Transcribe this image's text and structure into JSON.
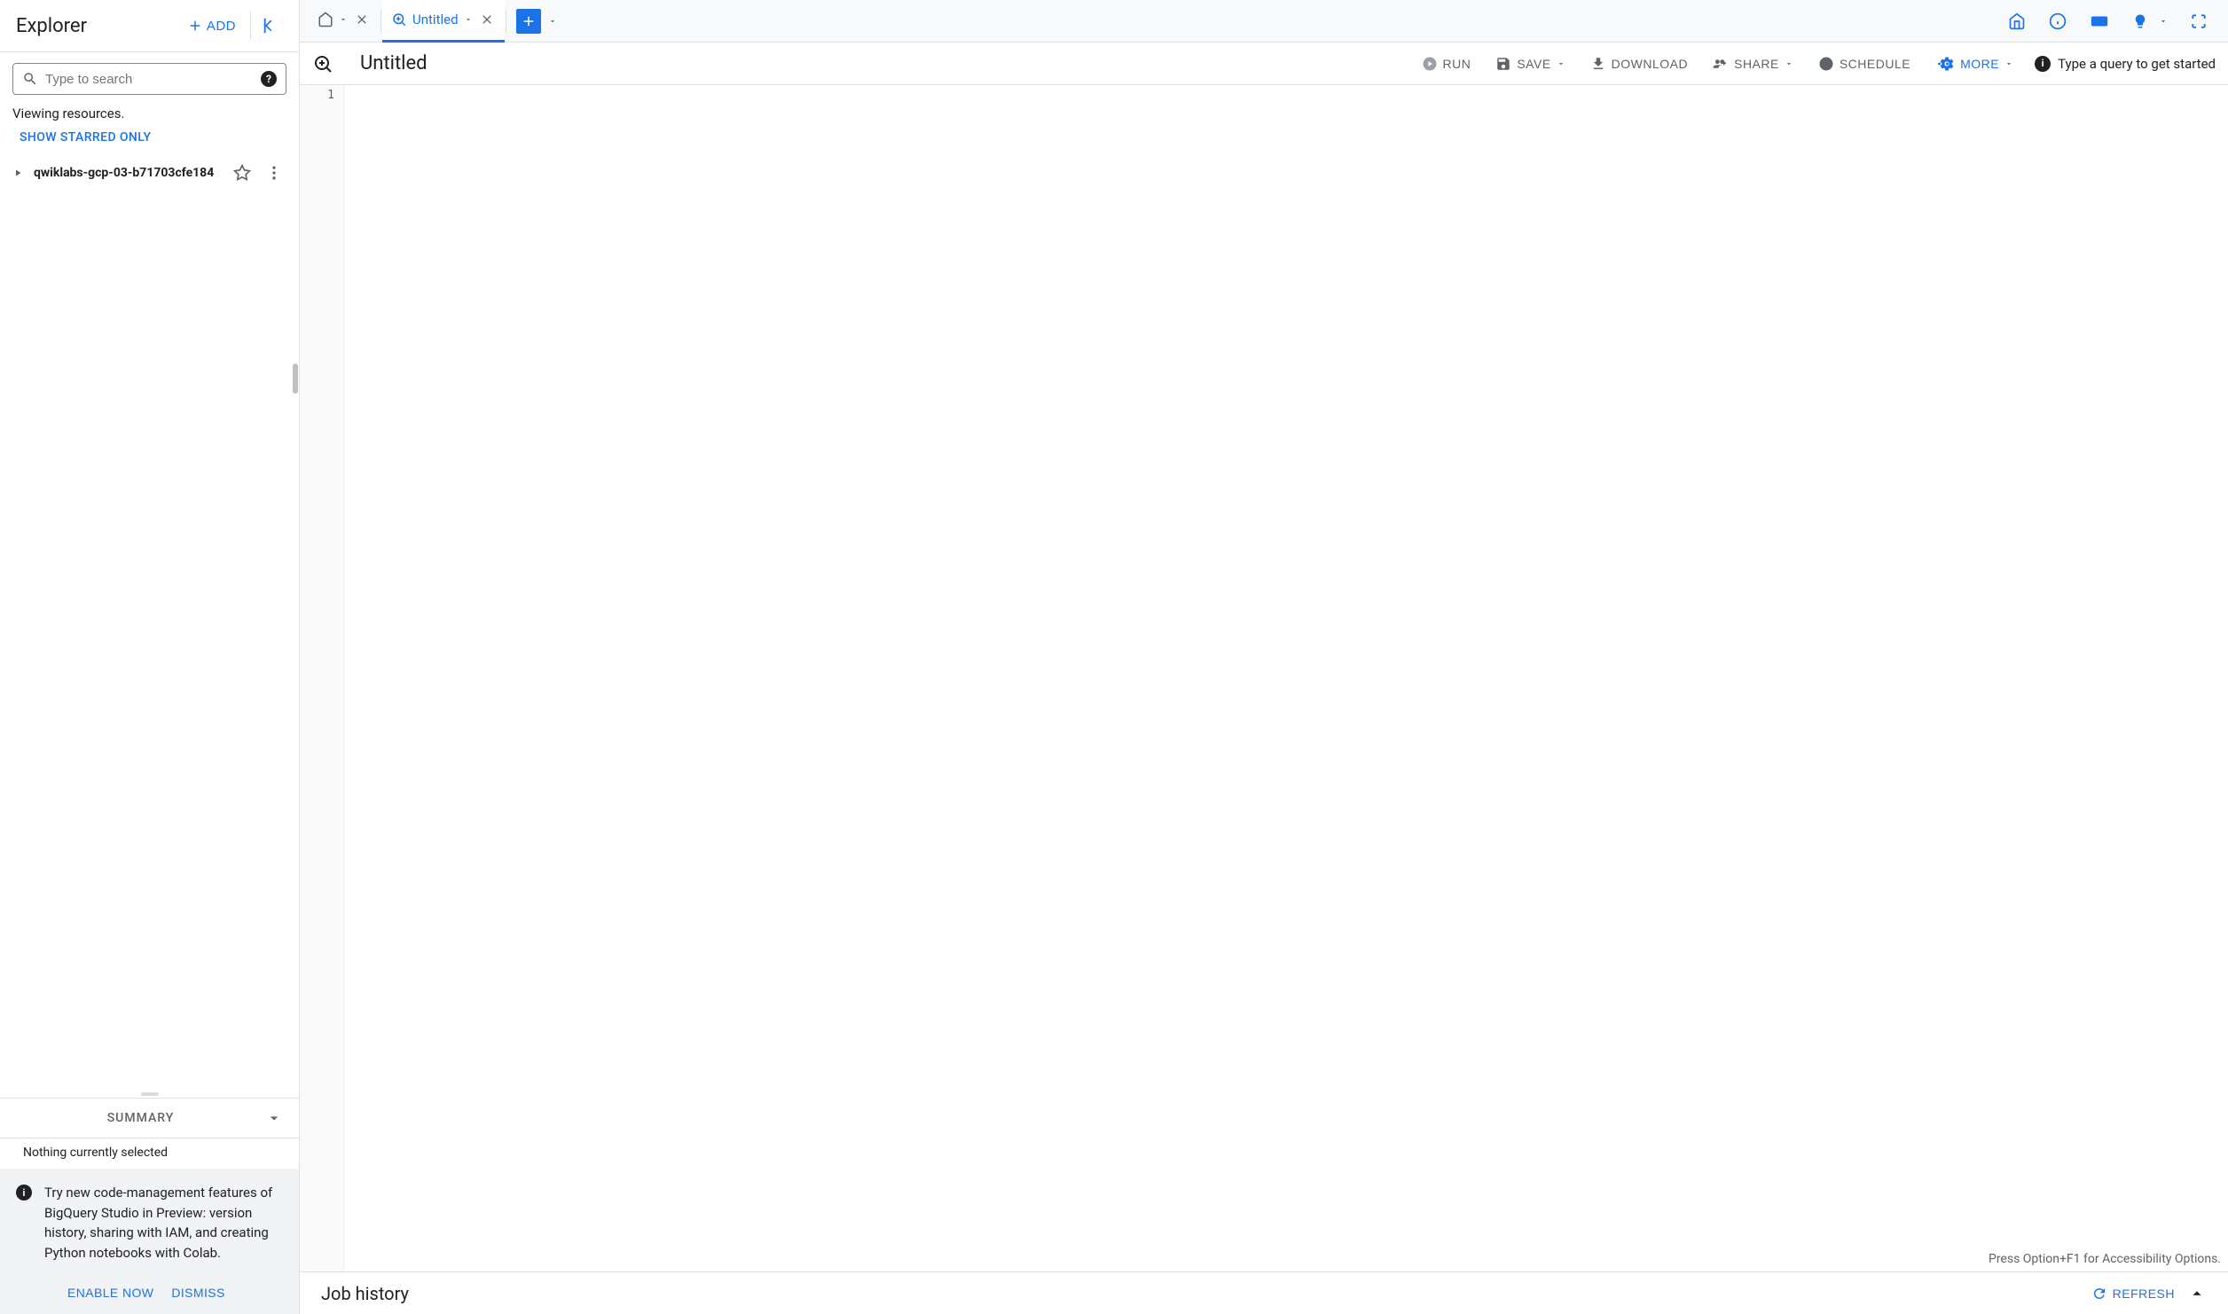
{
  "sidebar": {
    "title": "Explorer",
    "add_label": "ADD",
    "search_placeholder": "Type to search",
    "viewing_text": "Viewing resources.",
    "show_starred_label": "SHOW STARRED ONLY",
    "projects": [
      {
        "name": "qwiklabs-gcp-03-b71703cfe184"
      }
    ],
    "summary": {
      "header": "SUMMARY",
      "empty_text": "Nothing currently selected"
    },
    "banner": {
      "text": "Try new code-management features of BigQuery Studio in Preview: version history, sharing with IAM, and creating Python notebooks with Colab.",
      "enable_label": "ENABLE NOW",
      "dismiss_label": "DISMISS"
    }
  },
  "tabs": {
    "untitled_label": "Untitled"
  },
  "toolbar": {
    "query_title": "Untitled",
    "run_label": "RUN",
    "save_label": "SAVE",
    "download_label": "DOWNLOAD",
    "share_label": "SHARE",
    "schedule_label": "SCHEDULE",
    "more_label": "MORE",
    "hint_text": "Type a query to get started"
  },
  "editor": {
    "line_numbers": [
      "1"
    ],
    "accessibility_hint": "Press Option+F1 for Accessibility Options."
  },
  "job_history": {
    "title": "Job history",
    "refresh_label": "REFRESH"
  }
}
